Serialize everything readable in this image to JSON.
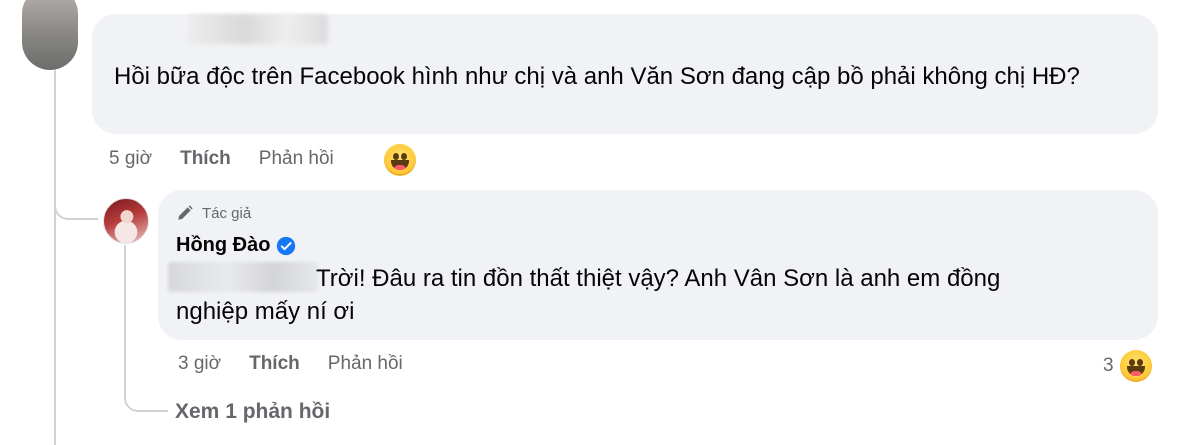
{
  "comment": {
    "text": "Hồi bữa độc trên Facebook hình như chị và anh Văn Sơn đang cập bồ phải không chị HĐ?",
    "time": "5 giờ",
    "like_label": "Thích",
    "reply_label": "Phản hồi",
    "reaction_icon": "grinning-face-emoji"
  },
  "reply": {
    "author_tag": "Tác giả",
    "author_name": "Hồng Đào",
    "text_line_1": "Trời! Đâu ra tin đồn thất thiệt vậy? Anh Vân Sơn là anh em đồng",
    "text_line_2": "nghiệp mấy ní ơi",
    "time": "3 giờ",
    "like_label": "Thích",
    "reply_label": "Phản hồi",
    "reaction_count": "3",
    "reaction_icon": "grinning-face-emoji"
  },
  "view_replies_label": "Xem 1 phản hồi",
  "colors": {
    "bubble_bg": "#f0f2f5",
    "meta_text": "#65676b",
    "verified_blue": "#1877f2"
  }
}
